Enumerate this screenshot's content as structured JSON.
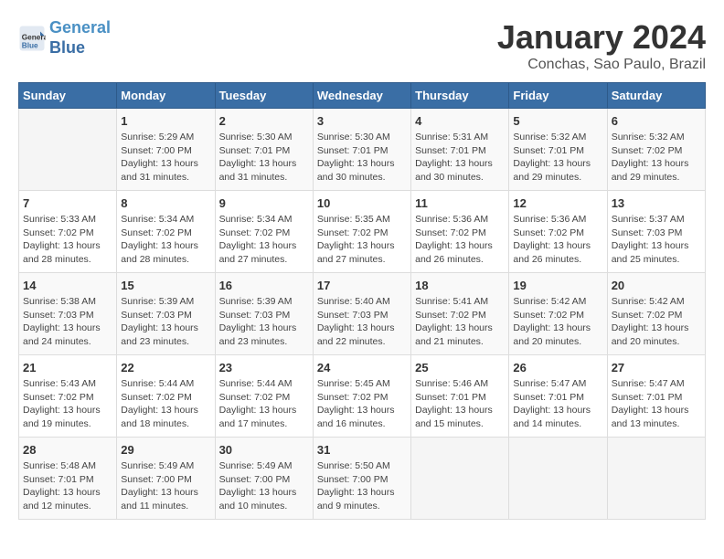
{
  "header": {
    "logo_line1": "General",
    "logo_line2": "Blue",
    "title": "January 2024",
    "subtitle": "Conchas, Sao Paulo, Brazil"
  },
  "days_of_week": [
    "Sunday",
    "Monday",
    "Tuesday",
    "Wednesday",
    "Thursday",
    "Friday",
    "Saturday"
  ],
  "weeks": [
    [
      {
        "day": "",
        "info": ""
      },
      {
        "day": "1",
        "info": "Sunrise: 5:29 AM\nSunset: 7:00 PM\nDaylight: 13 hours\nand 31 minutes."
      },
      {
        "day": "2",
        "info": "Sunrise: 5:30 AM\nSunset: 7:01 PM\nDaylight: 13 hours\nand 31 minutes."
      },
      {
        "day": "3",
        "info": "Sunrise: 5:30 AM\nSunset: 7:01 PM\nDaylight: 13 hours\nand 30 minutes."
      },
      {
        "day": "4",
        "info": "Sunrise: 5:31 AM\nSunset: 7:01 PM\nDaylight: 13 hours\nand 30 minutes."
      },
      {
        "day": "5",
        "info": "Sunrise: 5:32 AM\nSunset: 7:01 PM\nDaylight: 13 hours\nand 29 minutes."
      },
      {
        "day": "6",
        "info": "Sunrise: 5:32 AM\nSunset: 7:02 PM\nDaylight: 13 hours\nand 29 minutes."
      }
    ],
    [
      {
        "day": "7",
        "info": "Sunrise: 5:33 AM\nSunset: 7:02 PM\nDaylight: 13 hours\nand 28 minutes."
      },
      {
        "day": "8",
        "info": "Sunrise: 5:34 AM\nSunset: 7:02 PM\nDaylight: 13 hours\nand 28 minutes."
      },
      {
        "day": "9",
        "info": "Sunrise: 5:34 AM\nSunset: 7:02 PM\nDaylight: 13 hours\nand 27 minutes."
      },
      {
        "day": "10",
        "info": "Sunrise: 5:35 AM\nSunset: 7:02 PM\nDaylight: 13 hours\nand 27 minutes."
      },
      {
        "day": "11",
        "info": "Sunrise: 5:36 AM\nSunset: 7:02 PM\nDaylight: 13 hours\nand 26 minutes."
      },
      {
        "day": "12",
        "info": "Sunrise: 5:36 AM\nSunset: 7:02 PM\nDaylight: 13 hours\nand 26 minutes."
      },
      {
        "day": "13",
        "info": "Sunrise: 5:37 AM\nSunset: 7:03 PM\nDaylight: 13 hours\nand 25 minutes."
      }
    ],
    [
      {
        "day": "14",
        "info": "Sunrise: 5:38 AM\nSunset: 7:03 PM\nDaylight: 13 hours\nand 24 minutes."
      },
      {
        "day": "15",
        "info": "Sunrise: 5:39 AM\nSunset: 7:03 PM\nDaylight: 13 hours\nand 23 minutes."
      },
      {
        "day": "16",
        "info": "Sunrise: 5:39 AM\nSunset: 7:03 PM\nDaylight: 13 hours\nand 23 minutes."
      },
      {
        "day": "17",
        "info": "Sunrise: 5:40 AM\nSunset: 7:03 PM\nDaylight: 13 hours\nand 22 minutes."
      },
      {
        "day": "18",
        "info": "Sunrise: 5:41 AM\nSunset: 7:02 PM\nDaylight: 13 hours\nand 21 minutes."
      },
      {
        "day": "19",
        "info": "Sunrise: 5:42 AM\nSunset: 7:02 PM\nDaylight: 13 hours\nand 20 minutes."
      },
      {
        "day": "20",
        "info": "Sunrise: 5:42 AM\nSunset: 7:02 PM\nDaylight: 13 hours\nand 20 minutes."
      }
    ],
    [
      {
        "day": "21",
        "info": "Sunrise: 5:43 AM\nSunset: 7:02 PM\nDaylight: 13 hours\nand 19 minutes."
      },
      {
        "day": "22",
        "info": "Sunrise: 5:44 AM\nSunset: 7:02 PM\nDaylight: 13 hours\nand 18 minutes."
      },
      {
        "day": "23",
        "info": "Sunrise: 5:44 AM\nSunset: 7:02 PM\nDaylight: 13 hours\nand 17 minutes."
      },
      {
        "day": "24",
        "info": "Sunrise: 5:45 AM\nSunset: 7:02 PM\nDaylight: 13 hours\nand 16 minutes."
      },
      {
        "day": "25",
        "info": "Sunrise: 5:46 AM\nSunset: 7:01 PM\nDaylight: 13 hours\nand 15 minutes."
      },
      {
        "day": "26",
        "info": "Sunrise: 5:47 AM\nSunset: 7:01 PM\nDaylight: 13 hours\nand 14 minutes."
      },
      {
        "day": "27",
        "info": "Sunrise: 5:47 AM\nSunset: 7:01 PM\nDaylight: 13 hours\nand 13 minutes."
      }
    ],
    [
      {
        "day": "28",
        "info": "Sunrise: 5:48 AM\nSunset: 7:01 PM\nDaylight: 13 hours\nand 12 minutes."
      },
      {
        "day": "29",
        "info": "Sunrise: 5:49 AM\nSunset: 7:00 PM\nDaylight: 13 hours\nand 11 minutes."
      },
      {
        "day": "30",
        "info": "Sunrise: 5:49 AM\nSunset: 7:00 PM\nDaylight: 13 hours\nand 10 minutes."
      },
      {
        "day": "31",
        "info": "Sunrise: 5:50 AM\nSunset: 7:00 PM\nDaylight: 13 hours\nand 9 minutes."
      },
      {
        "day": "",
        "info": ""
      },
      {
        "day": "",
        "info": ""
      },
      {
        "day": "",
        "info": ""
      }
    ]
  ]
}
